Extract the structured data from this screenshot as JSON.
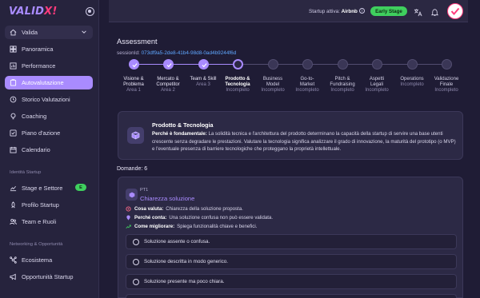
{
  "brand": {
    "logo_main": "VALID",
    "logo_mark": "X!"
  },
  "sidebar": {
    "group": {
      "label": "Valida"
    },
    "items": [
      {
        "label": "Panoramica",
        "icon": "dashboard-icon"
      },
      {
        "label": "Performance",
        "icon": "bar-chart-icon"
      },
      {
        "label": "Autovalutazione",
        "icon": "clipboard-icon",
        "active": true
      },
      {
        "label": "Storico Valutazioni",
        "icon": "history-icon"
      },
      {
        "label": "Coaching",
        "icon": "lightbulb-icon"
      },
      {
        "label": "Piano d'azione",
        "icon": "checklist-icon"
      },
      {
        "label": "Calendario",
        "icon": "calendar-icon"
      }
    ],
    "section_identity": "Identità Startup",
    "identity_items": [
      {
        "label": "Stage e Settore",
        "icon": "trend-icon",
        "badge": "E"
      },
      {
        "label": "Profilo Startup",
        "icon": "rocket-icon"
      },
      {
        "label": "Team e Ruoli",
        "icon": "team-icon"
      }
    ],
    "section_network": "Networking & Opportunità",
    "network_items": [
      {
        "label": "Ecosistema",
        "icon": "network-icon"
      },
      {
        "label": "Opportunità Startup",
        "icon": "megaphone-icon"
      }
    ]
  },
  "topbar": {
    "startup_prefix": "Startup attiva:",
    "startup_name": "Airbnb",
    "stage": "Early Stage",
    "icons": [
      "translate-icon",
      "bell-icon",
      "avatar"
    ]
  },
  "assessment": {
    "title": "Assessment",
    "session_label": "sessionId:",
    "session_id": "073df9a5-2de8-41b4-98d8-0ad4b9244f6d"
  },
  "steps": [
    {
      "line1": "Visione &",
      "line2": "Problema",
      "sub": "Area 1",
      "state": "done"
    },
    {
      "line1": "Mercato &",
      "line2": "Competitor",
      "sub": "Area 2",
      "state": "done"
    },
    {
      "line1": "Team & Skill",
      "line2": "",
      "sub": "Area 3",
      "state": "done"
    },
    {
      "line1": "Prodotto &",
      "line2": "Tecnologia",
      "sub": "Incompleto",
      "state": "current"
    },
    {
      "line1": "Business",
      "line2": "Model",
      "sub": "Incompleto",
      "state": "todo"
    },
    {
      "line1": "Go-to-",
      "line2": "Market",
      "sub": "Incompleto",
      "state": "todo"
    },
    {
      "line1": "Pitch &",
      "line2": "Fundraising",
      "sub": "Incompleto",
      "state": "todo"
    },
    {
      "line1": "Aspetti",
      "line2": "Legali",
      "sub": "Incompleto",
      "state": "todo"
    },
    {
      "line1": "Operations",
      "line2": "",
      "sub": "Incompleto",
      "state": "todo"
    },
    {
      "line1": "Validazione",
      "line2": "Finale",
      "sub": "Incompleto",
      "state": "todo"
    }
  ],
  "area_info": {
    "title": "Prodotto & Tecnologia",
    "why_label": "Perché è fondamentale:",
    "why_text": "La solidità tecnica e l'architettura del prodotto determinano la capacità della startup di servire una base utenti crescente senza degradare le prestazioni. Valutare la tecnologia significa analizzare il grado di innovazione, la maturità del prototipo (o MVP) e l'eventuale presenza di barriere tecnologiche che proteggano la proprietà intellettuale."
  },
  "questions_count_label": "Domande: 6",
  "question": {
    "code": "PT1",
    "title": "Chiarezza soluzione",
    "evaluates_label": "Cosa valuta:",
    "evaluates_text": "Chiarezza della soluzione proposta.",
    "why_label": "Perché conta:",
    "why_text": "Una soluzione confusa non può essere validata.",
    "improve_label": "Come migliorare:",
    "improve_text": "Spiega funzionalità chiave e benefici.",
    "options": [
      "Soluzione assente o confusa.",
      "Soluzione descritta in modo generico.",
      "Soluzione presente ma poco chiara."
    ]
  },
  "colors": {
    "accent": "#a98bff",
    "success": "#3fcf5e",
    "brand_pink": "#ff3b7d",
    "link": "#5fa7ff",
    "background": "#1f1c35"
  }
}
